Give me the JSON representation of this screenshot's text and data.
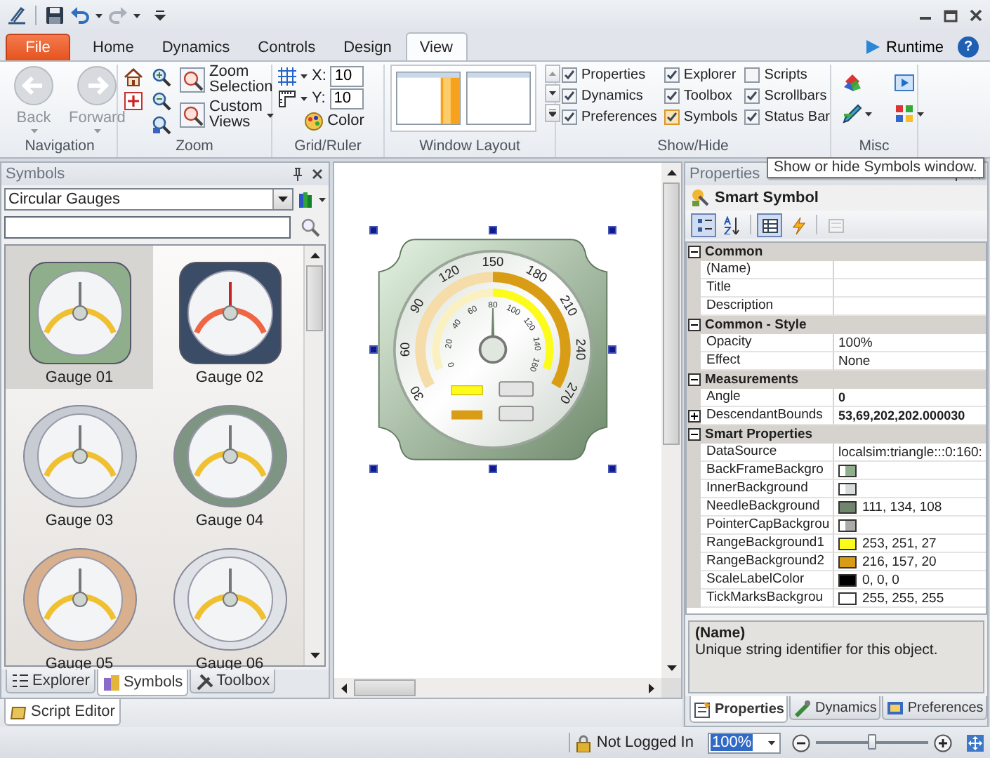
{
  "tab_bar": {
    "tabs": [
      {
        "label": "File",
        "kind": "file",
        "selected": false
      },
      {
        "label": "Home",
        "kind": "tab",
        "selected": false
      },
      {
        "label": "Dynamics",
        "kind": "tab",
        "selected": false
      },
      {
        "label": "Controls",
        "kind": "tab",
        "selected": false
      },
      {
        "label": "Design",
        "kind": "tab",
        "selected": false
      },
      {
        "label": "View",
        "kind": "tab",
        "selected": true
      }
    ],
    "runtime": "Runtime",
    "help": "?"
  },
  "ribbon": {
    "navigation": {
      "label": "Navigation",
      "buttons": [
        {
          "label": "Back",
          "disabled": true
        },
        {
          "label": "Forward",
          "disabled": true
        }
      ]
    },
    "zoom": {
      "label": "Zoom",
      "zoom_selection": "Zoom Selection",
      "custom_views": "Custom Views"
    },
    "grid_ruler": {
      "label": "Grid/Ruler",
      "x_label": "X:",
      "x_value": "10",
      "y_label": "Y:",
      "y_value": "10",
      "color_button": "Color"
    },
    "window_layout": {
      "label": "Window Layout"
    },
    "show_hide": {
      "label": "Show/Hide",
      "options": [
        {
          "label": "Properties",
          "checked": true,
          "hovered": false
        },
        {
          "label": "Explorer",
          "checked": true,
          "hovered": false
        },
        {
          "label": "Scripts",
          "checked": false,
          "hovered": false
        },
        {
          "label": "Dynamics",
          "checked": true,
          "hovered": false
        },
        {
          "label": "Toolbox",
          "checked": true,
          "hovered": false
        },
        {
          "label": "Scrollbars",
          "checked": true,
          "hovered": false
        },
        {
          "label": "Preferences",
          "checked": true,
          "hovered": false
        },
        {
          "label": "Symbols",
          "checked": true,
          "hovered": true
        },
        {
          "label": "Status Bar",
          "checked": true,
          "hovered": false
        }
      ]
    },
    "misc": {
      "label": "Misc"
    }
  },
  "tooltip": "Show or hide Symbols window.",
  "symbols": {
    "title": "Symbols",
    "category": "Circular Gauges",
    "items": [
      {
        "label": "Gauge 01",
        "selected": true
      },
      {
        "label": "Gauge 02",
        "selected": false
      },
      {
        "label": "Gauge 03",
        "selected": false
      },
      {
        "label": "Gauge 04",
        "selected": false
      },
      {
        "label": "Gauge 05",
        "selected": false
      },
      {
        "label": "Gauge 06",
        "selected": false
      }
    ],
    "tabs": [
      {
        "label": "Explorer",
        "selected": false
      },
      {
        "label": "Symbols",
        "selected": true
      },
      {
        "label": "Toolbox",
        "selected": false
      }
    ]
  },
  "canvas": {
    "selected": true,
    "gauge": {
      "outer_scale": [
        "30",
        "60",
        "90",
        "120",
        "150",
        "180",
        "210",
        "240",
        "270"
      ],
      "inner_scale": [
        "0",
        "20",
        "40",
        "60",
        "80",
        "100",
        "120",
        "140",
        "160"
      ]
    }
  },
  "script_editor": {
    "tab": "Script Editor"
  },
  "properties": {
    "title": "Properties",
    "object": "Smart Symbol",
    "toolbar": [
      {
        "kind": "categorized",
        "selected": true,
        "disabled": false
      },
      {
        "kind": "alphabetical",
        "selected": false,
        "disabled": false
      },
      {
        "kind": "properties",
        "selected": true,
        "disabled": false
      },
      {
        "kind": "events",
        "selected": false,
        "disabled": false
      },
      {
        "kind": "pages",
        "selected": false,
        "disabled": true
      }
    ],
    "categories": [
      {
        "name": "Common",
        "expanded": true,
        "rows": [
          {
            "name": "(Name)",
            "kind": "text"
          },
          {
            "name": "Title",
            "kind": "text"
          },
          {
            "name": "Description",
            "kind": "text"
          }
        ]
      },
      {
        "name": "Common - Style",
        "expanded": true,
        "rows": [
          {
            "name": "Opacity",
            "kind": "text",
            "value": "100%"
          },
          {
            "name": "Effect",
            "kind": "text",
            "value": "None"
          }
        ]
      },
      {
        "name": "Measurements",
        "expanded": true,
        "rows": [
          {
            "name": "Angle",
            "kind": "text",
            "value": "0",
            "modified": true
          },
          {
            "name": "DescendantBounds",
            "kind": "text",
            "value": "53,69,202,202.000030",
            "modified": true,
            "expanded": false
          }
        ]
      },
      {
        "name": "Smart Properties",
        "expanded": true,
        "rows": [
          {
            "name": "DataSource",
            "kind": "text",
            "value": "localsim:triangle:::0:160:"
          },
          {
            "name": "BackFrameBackgro",
            "kind": "gradient",
            "color": "#8fae8c"
          },
          {
            "name": "InnerBackground",
            "kind": "gradient",
            "color": "#d8dcd8"
          },
          {
            "name": "NeedleBackground",
            "kind": "solid",
            "color": "#6f866c",
            "value": "111, 134, 108"
          },
          {
            "name": "PointerCapBackgrou",
            "kind": "gradient",
            "color": "#a9aca9"
          },
          {
            "name": "RangeBackground1",
            "kind": "solid",
            "color": "#fdfb1b",
            "value": "253, 251, 27"
          },
          {
            "name": "RangeBackground2",
            "kind": "solid",
            "color": "#d89d14",
            "value": "216, 157, 20"
          },
          {
            "name": "ScaleLabelColor",
            "kind": "solid",
            "color": "#000000",
            "value": "0, 0, 0"
          },
          {
            "name": "TickMarksBackgrou",
            "kind": "solid",
            "color": "#ffffff",
            "value": "255, 255, 255"
          }
        ]
      }
    ],
    "description": {
      "title": "(Name)",
      "text": "Unique string identifier for this object."
    },
    "tabs": [
      {
        "label": "Properties",
        "selected": true
      },
      {
        "label": "Dynamics",
        "selected": false
      },
      {
        "label": "Preferences",
        "selected": false
      }
    ]
  },
  "status_bar": {
    "login": "Not Logged In",
    "zoom": "100%",
    "zoom_slider": {
      "level": 0.5
    }
  }
}
